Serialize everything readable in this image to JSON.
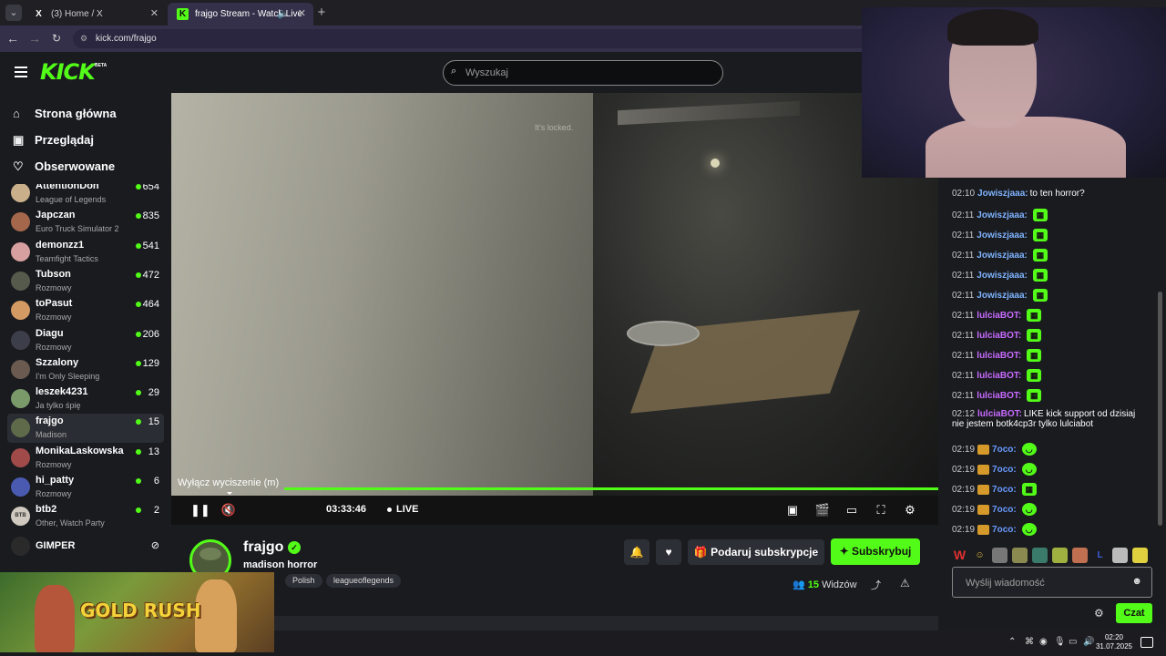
{
  "browser": {
    "tabs": [
      {
        "title": "(3) Home / X",
        "icon": "x-logo-icon"
      },
      {
        "title": "frajgo Stream - Watch Live",
        "icon": "kick-logo-icon",
        "muted": true
      }
    ],
    "new_tab": "+",
    "url": "kick.com/frajgo"
  },
  "kick": {
    "logo": "KICK",
    "beta": "BETA",
    "search_placeholder": "Wyszukaj",
    "nav": [
      {
        "label": "Strona główna",
        "icon": "home-icon"
      },
      {
        "label": "Przeglądaj",
        "icon": "browse-icon"
      },
      {
        "label": "Obserwowane",
        "icon": "heart-icon"
      }
    ],
    "channels": [
      {
        "name": "AttentionDon",
        "game": "League of Legends",
        "viewers": "654",
        "color": "#c9b08a"
      },
      {
        "name": "Japczan",
        "game": "Euro Truck Simulator 2",
        "viewers": "835",
        "color": "#a5674b"
      },
      {
        "name": "demonzz1",
        "game": "Teamfight Tactics",
        "viewers": "541",
        "color": "#d7a0a0"
      },
      {
        "name": "Tubson",
        "game": "Rozmowy",
        "viewers": "472",
        "color": "#555a4c"
      },
      {
        "name": "toPasut",
        "game": "Rozmowy",
        "viewers": "464",
        "color": "#d49a64"
      },
      {
        "name": "Diagu",
        "game": "Rozmowy",
        "viewers": "206",
        "color": "#3c3f4a"
      },
      {
        "name": "Szzalony",
        "game": "I'm Only Sleeping",
        "viewers": "129",
        "color": "#6a5a4f"
      },
      {
        "name": "leszek4231",
        "game": "Ja tylko śpię",
        "viewers": "29",
        "color": "#7a9a6a"
      },
      {
        "name": "frajgo",
        "game": "Madison",
        "viewers": "15",
        "color": "#5e6a4a",
        "active": true
      },
      {
        "name": "MonikaLaskowska",
        "game": "Rozmowy",
        "viewers": "13",
        "color": "#a04a4a"
      },
      {
        "name": "hi_patty",
        "game": "Rozmowy",
        "viewers": "6",
        "color": "#4a5ab0"
      },
      {
        "name": "btb2",
        "game": "Other, Watch Party",
        "viewers": "2",
        "color": "#cfc9bf",
        "initials": "BTB"
      }
    ],
    "offline_channel": {
      "name": "GIMPER",
      "icon": "video-off-icon"
    }
  },
  "player": {
    "overlay_text": "It's locked.",
    "tooltip": "Wyłącz wyciszenie (m)",
    "time": "03:33:46",
    "live": "LIVE",
    "progress": 1.0
  },
  "stream": {
    "streamer": "frajgo",
    "title": "madison horror",
    "tags": [
      "Polish",
      "leagueoflegends"
    ],
    "tag_partial": "n",
    "gift_label": "Podaruj subskrypcje",
    "subscribe_label": "Subskrybuj",
    "viewers_count": "15",
    "viewers_label": "Widzów"
  },
  "chat": {
    "messages": [
      {
        "time": "02:10",
        "user": "Jowiszjaaa:",
        "color": "#7fb3ff",
        "text": "to ten horror?"
      },
      {
        "time": "02:11",
        "user": "Jowiszjaaa:",
        "color": "#7fb3ff",
        "emote": "angry"
      },
      {
        "time": "02:11",
        "user": "Jowiszjaaa:",
        "color": "#7fb3ff",
        "emote": "angry"
      },
      {
        "time": "02:11",
        "user": "Jowiszjaaa:",
        "color": "#7fb3ff",
        "emote": "angry"
      },
      {
        "time": "02:11",
        "user": "Jowiszjaaa:",
        "color": "#7fb3ff",
        "emote": "angry"
      },
      {
        "time": "02:11",
        "user": "Jowiszjaaa:",
        "color": "#7fb3ff",
        "emote": "angry"
      },
      {
        "time": "02:11",
        "user": "lulciaBOT:",
        "color": "#c86bff",
        "emote": "angry"
      },
      {
        "time": "02:11",
        "user": "lulciaBOT:",
        "color": "#c86bff",
        "emote": "angry"
      },
      {
        "time": "02:11",
        "user": "lulciaBOT:",
        "color": "#c86bff",
        "emote": "angry"
      },
      {
        "time": "02:11",
        "user": "lulciaBOT:",
        "color": "#c86bff",
        "emote": "angry"
      },
      {
        "time": "02:11",
        "user": "lulciaBOT:",
        "color": "#c86bff",
        "emote": "angry"
      },
      {
        "time": "02:12",
        "user": "lulciaBOT:",
        "color": "#c86bff",
        "text": "LIKE kick support od dzisiaj",
        "text2": "nie jestem botk4cp3r tylko lulciabot"
      },
      {
        "time": "02:19",
        "user": "7oco:",
        "color": "#6b9bff",
        "emote": "smile",
        "crown": true
      },
      {
        "time": "02:19",
        "user": "7oco:",
        "color": "#6b9bff",
        "emote": "smile",
        "crown": true
      },
      {
        "time": "02:19",
        "user": "7oco:",
        "color": "#6b9bff",
        "emote": "angry",
        "crown": true
      },
      {
        "time": "02:19",
        "user": "7oco:",
        "color": "#6b9bff",
        "emote": "smile",
        "crown": true
      },
      {
        "time": "02:19",
        "user": "7oco:",
        "color": "#6b9bff",
        "emote": "smile",
        "crown": true
      }
    ],
    "input_placeholder": "Wyślij wiadomość",
    "send_label": "Czat"
  },
  "ad": {
    "title": "GOLD RUSH"
  },
  "taskbar": {
    "time": "02:20",
    "date": "31.07.2025"
  },
  "colors": {
    "accent": "#53fc18",
    "bg": "#191b1f"
  }
}
